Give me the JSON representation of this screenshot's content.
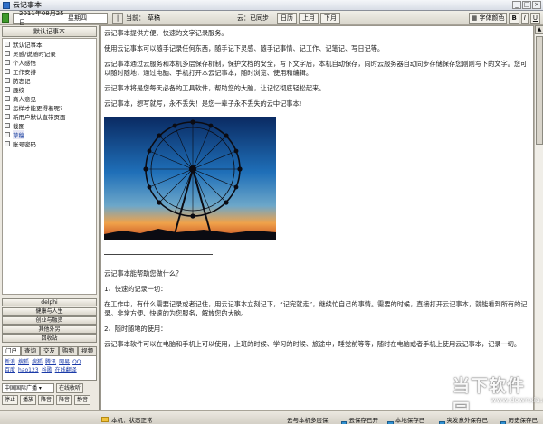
{
  "window": {
    "title": "云记事本"
  },
  "toolbar": {
    "date": "2011年08月25日",
    "weekday": "星期四",
    "current_label": "当前：",
    "current_value": "草稿",
    "cloud_sync": "云：已同步",
    "buttons": [
      "日历",
      "上月",
      "下月"
    ],
    "font_color_label": "字体颜色",
    "fmt_bold": "B",
    "fmt_italic": "I",
    "fmt_underline": "U"
  },
  "sidebar": {
    "header": "默认记事本",
    "items": [
      {
        "label": "默认记事本",
        "selected": false
      },
      {
        "label": "灵感/说随时记录",
        "selected": false
      },
      {
        "label": "个人感悟",
        "selected": false
      },
      {
        "label": "工作安排",
        "selected": false
      },
      {
        "label": "防忘记",
        "selected": false
      },
      {
        "label": "趣绞",
        "selected": false
      },
      {
        "label": "商人意见",
        "selected": false
      },
      {
        "label": "怎样才能更得着呢?",
        "selected": false
      },
      {
        "label": "新用户默认直带页面",
        "selected": false
      },
      {
        "label": "截图",
        "selected": false
      },
      {
        "label": "草稿",
        "selected": true
      },
      {
        "label": "账号密码",
        "selected": false
      }
    ],
    "sections": [
      "delphi",
      "健康与人生",
      "创业与融资",
      "其他外另",
      "回收站"
    ],
    "tabs": [
      "门户",
      "查询",
      "交友",
      "购物",
      "视频"
    ],
    "links": [
      "新浪",
      "搜狐",
      "搜狐",
      "腾讯",
      "网易",
      "QQ",
      "百度",
      "hao123",
      "谷歌",
      "在线翻译"
    ],
    "radio_station": "中国国际广播",
    "online_radio": "在线收听",
    "controls": [
      "停止",
      "播放",
      "降音",
      "降音",
      "静音"
    ]
  },
  "editor": {
    "paragraphs_top": [
      "云记事本提供方便、快速的文字记录服务。",
      "使用云记事本可以随手记录任何东西，随手记下灵感、随手记事情、记工作、记笔记、写日记等。",
      "云记事本通过云服务和本机多层保存机制，保护文档的安全，写下文字后，本机自动保存，同时云服务器自动同步存储保存您刚刚写下的文字。您可以随时随地，通过电脑、手机打开本云记事本，随时浏览、使用和编辑。",
      "云记事本将是您每天必备的工具软件，帮助您的大脑，让记忆彻底轻松起来。",
      "云记事本，想写就写，永不丢失！是您一辈子永不丢失的云中记事本!"
    ],
    "paragraphs_bottom": [
      "云记事本能帮助您做什么？",
      "1、快速的记录一切：",
      "在工作中，有什么需要记录或者记住，用云记事本立刻记下，“记完就走”，继续忙自己的事情。需要的时候，直接打开云记事本，就能看到所有的记录。非常方便、快速的为您服务，解放您的大脑。",
      "2、随时随地的使用：",
      "云记事本软件可以在电脑和手机上可以使用，上班的时候、学习的时候、旅途中，睡觉前等等，随时在电脑或者手机上使用云记事本，记录一切。"
    ]
  },
  "status": {
    "local": "本机：状态正常",
    "cloud_multi": "云与本机多层保存：",
    "items": [
      "云保存已开启",
      "本地保存已开启",
      "突发意外保存已开启",
      "历史保存已开启"
    ]
  },
  "watermark": {
    "main": "当下软件园",
    "sub": "www.downxia.com"
  }
}
